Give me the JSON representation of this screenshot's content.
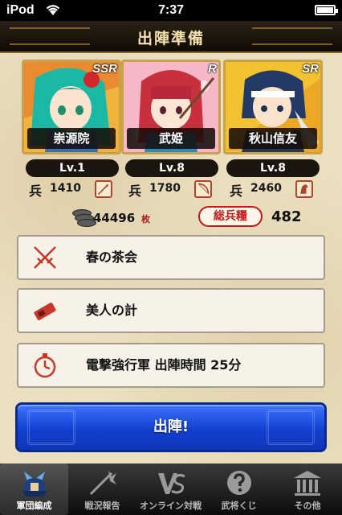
{
  "status_bar": {
    "carrier": "iPod",
    "time": "7:37",
    "wifi_icon": "wifi-icon",
    "battery_icon": "battery-icon"
  },
  "header": {
    "title": "出陣準備"
  },
  "generals": [
    {
      "name": "崇源院",
      "rarity": "SSR",
      "level": "Lv.1",
      "troop_label": "兵",
      "troops": "1410",
      "weapon_icon": "spear-icon"
    },
    {
      "name": "武姫",
      "rarity": "R",
      "level": "Lv.8",
      "troop_label": "兵",
      "troops": "1780",
      "weapon_icon": "bow-icon"
    },
    {
      "name": "秋山信友",
      "rarity": "SR",
      "level": "Lv.8",
      "troop_label": "兵",
      "troops": "2460",
      "weapon_icon": "cavalry-icon"
    }
  ],
  "resources": {
    "coins": "44496",
    "coins_unit": "枚",
    "total_troops_label": "総兵糧",
    "total_troops": "482"
  },
  "options": [
    {
      "label": "春の茶会",
      "icon": "crossed-swords-icon"
    },
    {
      "label": "美人の計",
      "icon": "scroll-icon"
    },
    {
      "label": "電撃強行軍 出陣時間 25分",
      "icon": "stopwatch-icon"
    }
  ],
  "sortie_button": {
    "label": "出陣!"
  },
  "tabs": [
    {
      "label": "軍団編成",
      "icon": "samurai-helmet-icon",
      "active": true
    },
    {
      "label": "戦況報告",
      "icon": "weapon-explosion-icon",
      "active": false
    },
    {
      "label": "オンライン対戦",
      "icon": "versus-icon",
      "active": false
    },
    {
      "label": "武将くじ",
      "icon": "question-mark-icon",
      "active": false
    },
    {
      "label": "その他",
      "icon": "temple-icon",
      "active": false
    }
  ],
  "colors": {
    "parchment": "#eadfc0",
    "header_bg": "#1c140c",
    "header_text": "#f4e2b0",
    "card_border": "#c9a14b",
    "sortie_blue": "#1440d0",
    "accent_red": "#c21a1a"
  }
}
